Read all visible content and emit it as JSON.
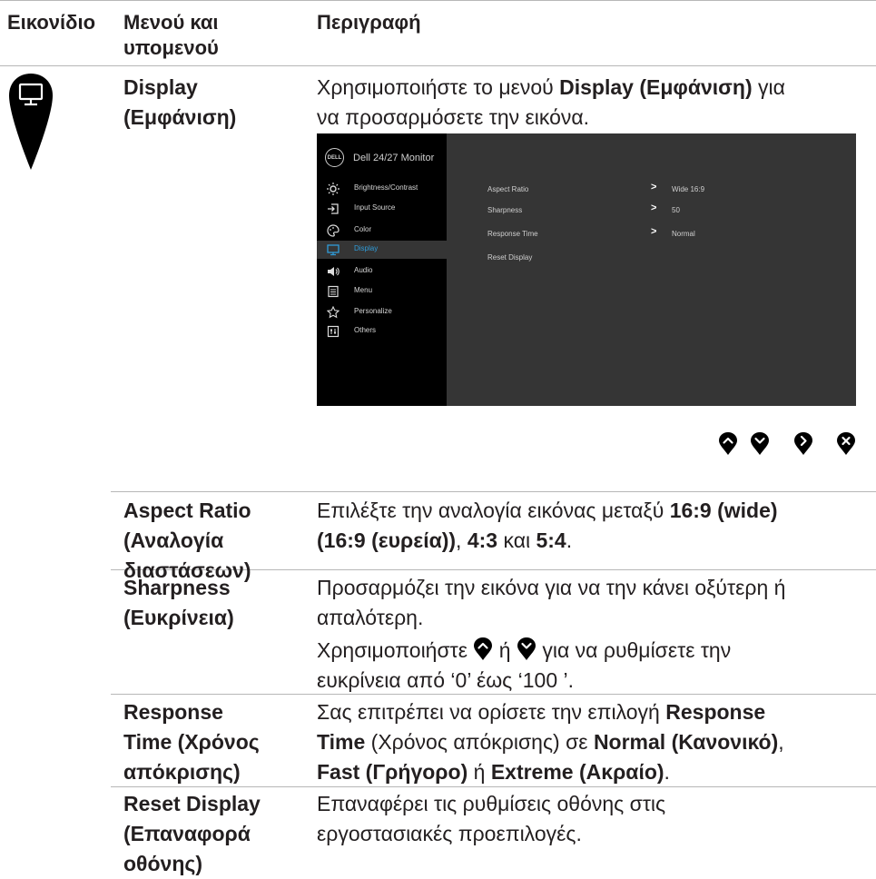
{
  "header": {
    "col_icon": "Εικονίδιο",
    "col_menu_line1": "Μενού και",
    "col_menu_line2": "υπομενού",
    "col_desc": "Περιγραφή"
  },
  "display": {
    "name_line1": "Display",
    "name_line2": "(Εμφάνιση)",
    "desc_pre": "Χρησιμοποιήστε το μενού ",
    "desc_bold": "Display (Εμφάνιση)",
    "desc_post": " για",
    "desc_line2": "να προσαρμόσετε την εικόνα."
  },
  "osd": {
    "logo": "DELL",
    "model": "Dell 24/27 Monitor",
    "menu": [
      {
        "label": "Brightness/Contrast",
        "icon": "brightness-icon"
      },
      {
        "label": "Input Source",
        "icon": "input-source-icon"
      },
      {
        "label": "Color",
        "icon": "color-icon"
      },
      {
        "label": "Display",
        "icon": "display-icon"
      },
      {
        "label": "Audio",
        "icon": "audio-icon"
      },
      {
        "label": "Menu",
        "icon": "menu-icon"
      },
      {
        "label": "Personalize",
        "icon": "star-icon"
      },
      {
        "label": "Others",
        "icon": "others-icon"
      }
    ],
    "rows": [
      {
        "label": "Aspect Ratio",
        "value": "Wide 16:9"
      },
      {
        "label": "Sharpness",
        "value": "50"
      },
      {
        "label": "Response Time",
        "value": "Normal"
      },
      {
        "label": "Reset Display",
        "value": ""
      }
    ],
    "accent": "#2f9bd8"
  },
  "nav_buttons": [
    "up-icon",
    "down-icon",
    "right-icon",
    "close-icon"
  ],
  "aspect": {
    "name_line1": "Aspect Ratio",
    "name_line2": "(Αναλογία",
    "name_line3": "διαστάσεων)",
    "l1_pre": "Επιλέξτε την αναλογία εικόνας μεταξύ ",
    "l1_bold": "16:9 (wide)",
    "l2_bold1": "(16:9 (ευρεία))",
    "l2_sep1": ", ",
    "l2_bold2": "4:3",
    "l2_sep2": " και ",
    "l2_bold3": "5:4",
    "l2_end": "."
  },
  "sharpness": {
    "name_line1": "Sharpness",
    "name_line2": "(Ευκρίνεια)",
    "line1": "Προσαρμόζει την εικόνα για να την κάνει οξύτερη ή",
    "line2": "απαλότερη.",
    "l3_pre": "Χρησιμοποιήστε",
    "l3_mid": "ή",
    "l3_post": "για να ρυθμίσετε την",
    "line4": "ευκρίνεια από ‘0’ έως ‘100 ’."
  },
  "response": {
    "name_line1": "Response",
    "name_line2": "Time (Χρόνος",
    "name_line3": "απόκρισης)",
    "l1_pre": "Σας επιτρέπει να ορίσετε την επιλογή ",
    "l1_bold": "Response",
    "l2_bold1": "Time",
    "l2_mid": " (Χρόνος απόκρισης) σε ",
    "l2_bold2": "Normal (Κανονικό)",
    "l2_end": ",",
    "l3_bold1": "Fast (Γρήγορο)",
    "l3_mid": " ή ",
    "l3_bold2": "Extreme (Ακραίο)",
    "l3_end": "."
  },
  "reset": {
    "name_line1": "Reset Display",
    "name_line2": "(Επαναφορά",
    "name_line3": "οθόνης)",
    "line1": "Επαναφέρει τις ρυθμίσεις οθόνης στις",
    "line2": "εργοστασιακές προεπιλογές."
  }
}
